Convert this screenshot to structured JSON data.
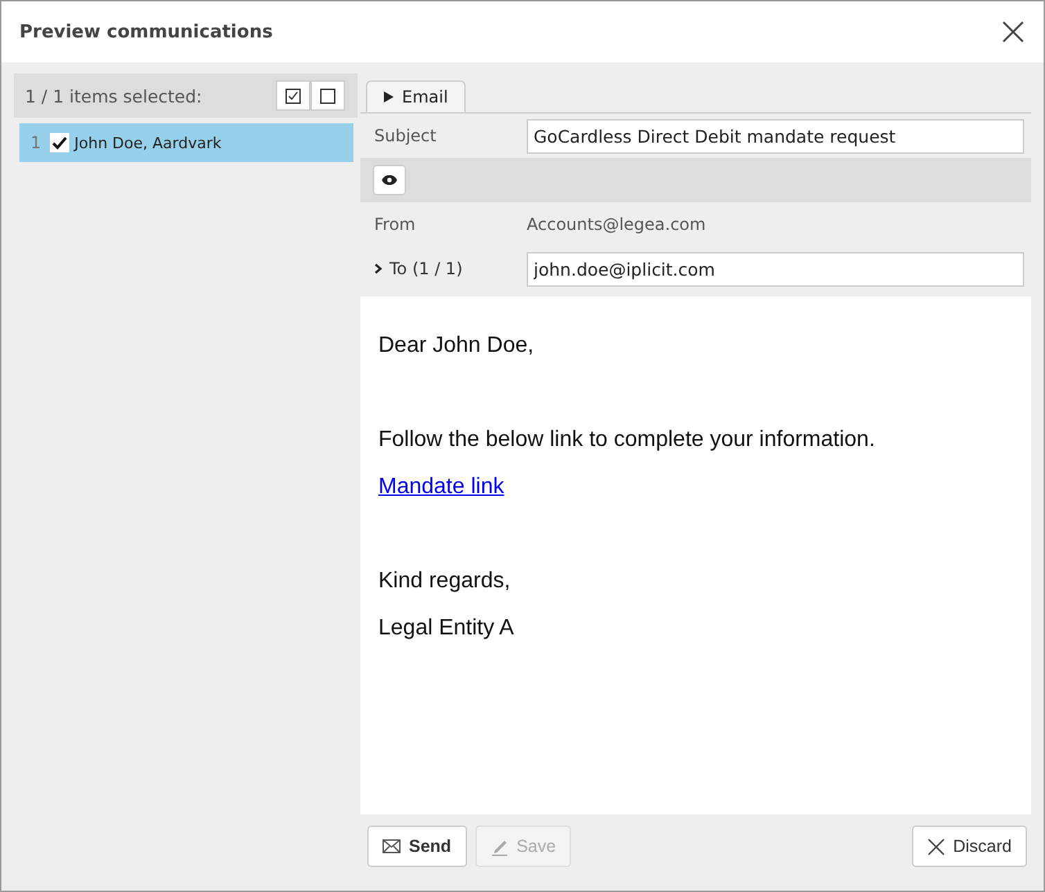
{
  "window": {
    "title": "Preview communications"
  },
  "list": {
    "summary": "1 / 1 items selected:",
    "items": [
      {
        "index": "1",
        "label": "John Doe, Aardvark",
        "checked": true,
        "selected": true
      }
    ]
  },
  "tabs": [
    {
      "label": "Email",
      "selected": true
    }
  ],
  "fields": {
    "subject_label": "Subject",
    "subject": "GoCardless Direct Debit mandate request",
    "from_label": "From",
    "from": "Accounts@legea.com",
    "to_label": "To (1 / 1)",
    "to": "john.doe@iplicit.com"
  },
  "body": [
    {
      "kind": "text",
      "text": "Dear John Doe,"
    },
    {
      "kind": "gap"
    },
    {
      "kind": "text",
      "text": "Follow the below link to complete your information."
    },
    {
      "kind": "link",
      "text": "Mandate link"
    },
    {
      "kind": "gap"
    },
    {
      "kind": "text",
      "text": "Kind regards,"
    },
    {
      "kind": "text",
      "text": "Legal Entity A"
    }
  ],
  "buttons": [
    {
      "kind": "send",
      "label": "Send",
      "disabled": false
    },
    {
      "kind": "save",
      "label": "Save",
      "disabled": true
    },
    {
      "kind": "discard",
      "label": "Discard",
      "disabled": false
    }
  ]
}
